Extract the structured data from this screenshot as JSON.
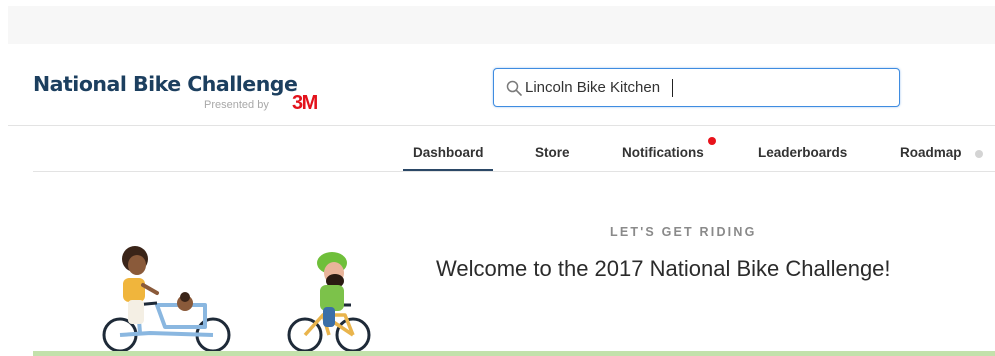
{
  "header": {
    "logo_title": "National Bike Challenge",
    "logo_presented": "Presented by",
    "logo_sponsor": "3M"
  },
  "search": {
    "value": "Lincoln Bike Kitchen",
    "icon": "search-icon"
  },
  "nav": {
    "items": [
      {
        "label": "Dashboard",
        "active": true
      },
      {
        "label": "Store"
      },
      {
        "label": "Notifications",
        "has_alert": true
      },
      {
        "label": "Leaderboards"
      },
      {
        "label": "Roadmap"
      }
    ]
  },
  "hero": {
    "eyebrow": "LET'S GET RIDING",
    "welcome": "Welcome to the 2017 National Bike Challenge!"
  },
  "colors": {
    "brand_navy": "#1c3f5f",
    "sponsor_red": "#e3121b",
    "search_focus_blue": "#3f8ce0",
    "notification_red": "#e8121b",
    "accent_green": "#c3e1ab"
  }
}
